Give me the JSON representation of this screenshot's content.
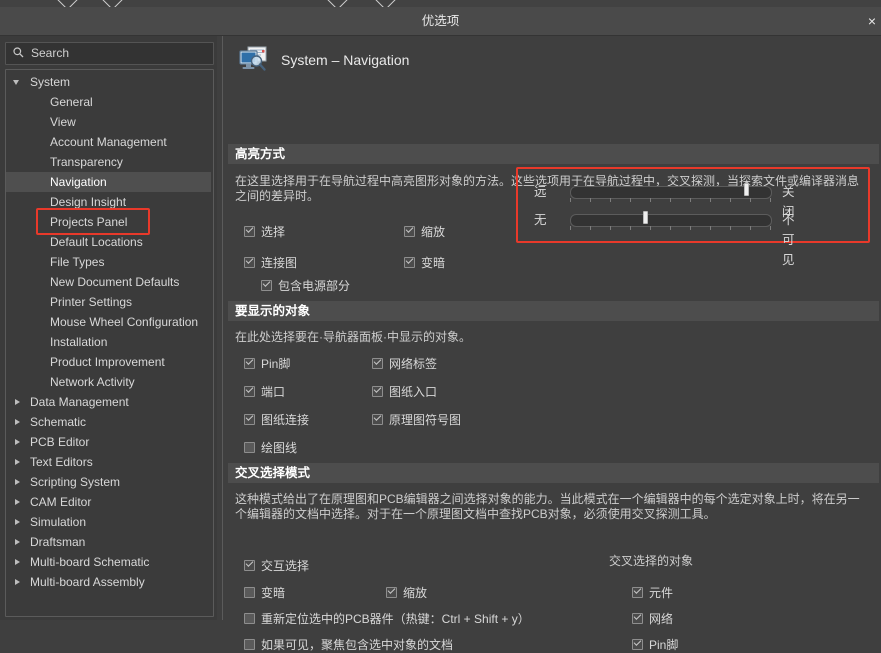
{
  "window": {
    "title": "优选项",
    "close_label": "×"
  },
  "search": {
    "placeholder": "Search",
    "value": "",
    "icon": "search-icon"
  },
  "sidebar": {
    "items": [
      {
        "label": "System",
        "level": 0,
        "arrow": "open",
        "selected": false
      },
      {
        "label": "General",
        "level": 1,
        "arrow": "none",
        "selected": false
      },
      {
        "label": "View",
        "level": 1,
        "arrow": "none",
        "selected": false
      },
      {
        "label": "Account Management",
        "level": 1,
        "arrow": "none",
        "selected": false
      },
      {
        "label": "Transparency",
        "level": 1,
        "arrow": "none",
        "selected": false
      },
      {
        "label": "Navigation",
        "level": 1,
        "arrow": "none",
        "selected": true
      },
      {
        "label": "Design Insight",
        "level": 1,
        "arrow": "none",
        "selected": false
      },
      {
        "label": "Projects Panel",
        "level": 1,
        "arrow": "none",
        "selected": false
      },
      {
        "label": "Default Locations",
        "level": 1,
        "arrow": "none",
        "selected": false
      },
      {
        "label": "File Types",
        "level": 1,
        "arrow": "none",
        "selected": false
      },
      {
        "label": "New Document Defaults",
        "level": 1,
        "arrow": "none",
        "selected": false
      },
      {
        "label": "Printer Settings",
        "level": 1,
        "arrow": "none",
        "selected": false
      },
      {
        "label": "Mouse Wheel Configuration",
        "level": 1,
        "arrow": "none",
        "selected": false
      },
      {
        "label": "Installation",
        "level": 1,
        "arrow": "none",
        "selected": false
      },
      {
        "label": "Product Improvement",
        "level": 1,
        "arrow": "none",
        "selected": false
      },
      {
        "label": "Network Activity",
        "level": 1,
        "arrow": "none",
        "selected": false
      },
      {
        "label": "Data Management",
        "level": 0,
        "arrow": "closed",
        "selected": false
      },
      {
        "label": "Schematic",
        "level": 0,
        "arrow": "closed",
        "selected": false
      },
      {
        "label": "PCB Editor",
        "level": 0,
        "arrow": "closed",
        "selected": false
      },
      {
        "label": "Text Editors",
        "level": 0,
        "arrow": "closed",
        "selected": false
      },
      {
        "label": "Scripting System",
        "level": 0,
        "arrow": "closed",
        "selected": false
      },
      {
        "label": "CAM Editor",
        "level": 0,
        "arrow": "closed",
        "selected": false
      },
      {
        "label": "Simulation",
        "level": 0,
        "arrow": "closed",
        "selected": false
      },
      {
        "label": "Draftsman",
        "level": 0,
        "arrow": "closed",
        "selected": false
      },
      {
        "label": "Multi-board Schematic",
        "level": 0,
        "arrow": "closed",
        "selected": false
      },
      {
        "label": "Multi-board Assembly",
        "level": 0,
        "arrow": "closed",
        "selected": false
      }
    ]
  },
  "page": {
    "title": "System – Navigation",
    "icon": "monitor-magnifier-icon"
  },
  "sections": {
    "highlight": {
      "title": "高亮方式",
      "description": "在这里选择用于在导航过程中高亮图形对象的方法。这些选项用于在导航过程中，交叉探测，当探索文件或编译器消息之间的差异时。",
      "checkboxes": [
        {
          "label": "选择",
          "checked": true
        },
        {
          "label": "缩放",
          "checked": true
        },
        {
          "label": "连接图",
          "checked": true
        },
        {
          "label": "变暗",
          "checked": true
        },
        {
          "label": "包含电源部分",
          "checked": true
        }
      ],
      "sliders": [
        {
          "left_label": "远",
          "right_label": "关闭",
          "value": 90,
          "ticks": 11
        },
        {
          "left_label": "无",
          "right_label": "不可见",
          "value": 38,
          "ticks": 11
        }
      ]
    },
    "objects": {
      "title": "要显示的对象",
      "description": "在此处选择要在·导航器面板·中显示的对象。",
      "col1": [
        {
          "label": "Pin脚",
          "checked": true
        },
        {
          "label": "端口",
          "checked": true
        },
        {
          "label": "图纸连接",
          "checked": true
        },
        {
          "label": "绘图线",
          "checked": false
        }
      ],
      "col2": [
        {
          "label": "网络标签",
          "checked": true
        },
        {
          "label": "图纸入口",
          "checked": true
        },
        {
          "label": "原理图符号图",
          "checked": true
        }
      ]
    },
    "crossselect": {
      "title": "交叉选择模式",
      "description": "这种模式给出了在原理图和PCB编辑器之间选择对象的能力。当此模式在一个编辑器中的每个选定对象上时，将在另一个编辑器的文档中选择。对于在一个原理图文档中查找PCB对象，必须使用交叉探测工具。",
      "main_checkbox": {
        "label": "交互选择",
        "checked": true
      },
      "left_checkboxes": [
        {
          "label": "变暗",
          "checked": false
        },
        {
          "label": "重新定位选中的PCB器件（热键：Ctrl + Shift + y）",
          "checked": false
        },
        {
          "label": "如果可见，聚焦包含选中对象的文档",
          "checked": false
        }
      ],
      "mid_checkboxes": [
        {
          "label": "缩放",
          "checked": true
        }
      ],
      "right_group_title": "交叉选择的对象",
      "right_checkboxes": [
        {
          "label": "元件",
          "checked": true
        },
        {
          "label": "网络",
          "checked": true
        },
        {
          "label": "Pin脚",
          "checked": true
        }
      ]
    }
  },
  "colors": {
    "highlight_red": "#e8392a",
    "panel_bg": "#3f3f3f",
    "section_bar": "#4d4d4d",
    "selection": "#4f4f4f"
  }
}
